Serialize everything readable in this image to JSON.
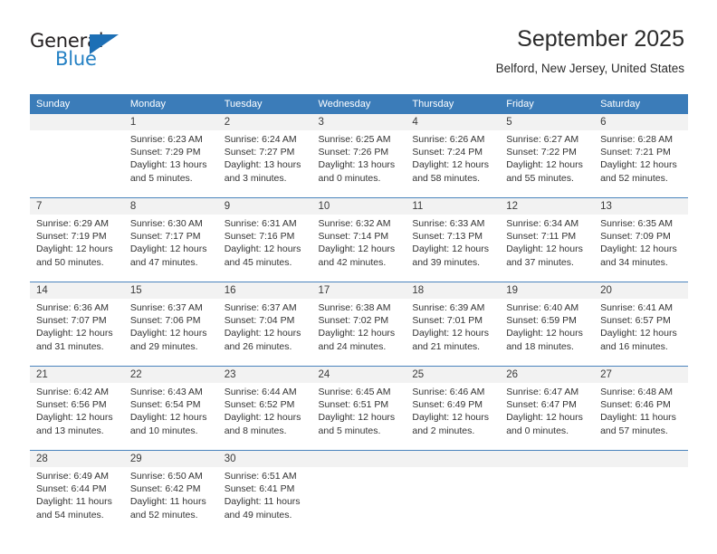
{
  "brand": {
    "name_part1": "General",
    "name_part2": "Blue"
  },
  "header": {
    "title": "September 2025",
    "subtitle": "Belford, New Jersey, United States"
  },
  "colors": {
    "header_blue": "#3b7cb9",
    "separator_blue": "#4a84bd",
    "daynum_bg": "#f2f2f2",
    "logo_blue": "#2581c4"
  },
  "weekday_headers": [
    "Sunday",
    "Monday",
    "Tuesday",
    "Wednesday",
    "Thursday",
    "Friday",
    "Saturday"
  ],
  "weeks": [
    {
      "days": [
        {
          "num": "",
          "sunrise": "",
          "sunset": "",
          "daylight1": "",
          "daylight2": ""
        },
        {
          "num": "1",
          "sunrise": "Sunrise: 6:23 AM",
          "sunset": "Sunset: 7:29 PM",
          "daylight1": "Daylight: 13 hours",
          "daylight2": "and 5 minutes."
        },
        {
          "num": "2",
          "sunrise": "Sunrise: 6:24 AM",
          "sunset": "Sunset: 7:27 PM",
          "daylight1": "Daylight: 13 hours",
          "daylight2": "and 3 minutes."
        },
        {
          "num": "3",
          "sunrise": "Sunrise: 6:25 AM",
          "sunset": "Sunset: 7:26 PM",
          "daylight1": "Daylight: 13 hours",
          "daylight2": "and 0 minutes."
        },
        {
          "num": "4",
          "sunrise": "Sunrise: 6:26 AM",
          "sunset": "Sunset: 7:24 PM",
          "daylight1": "Daylight: 12 hours",
          "daylight2": "and 58 minutes."
        },
        {
          "num": "5",
          "sunrise": "Sunrise: 6:27 AM",
          "sunset": "Sunset: 7:22 PM",
          "daylight1": "Daylight: 12 hours",
          "daylight2": "and 55 minutes."
        },
        {
          "num": "6",
          "sunrise": "Sunrise: 6:28 AM",
          "sunset": "Sunset: 7:21 PM",
          "daylight1": "Daylight: 12 hours",
          "daylight2": "and 52 minutes."
        }
      ]
    },
    {
      "days": [
        {
          "num": "7",
          "sunrise": "Sunrise: 6:29 AM",
          "sunset": "Sunset: 7:19 PM",
          "daylight1": "Daylight: 12 hours",
          "daylight2": "and 50 minutes."
        },
        {
          "num": "8",
          "sunrise": "Sunrise: 6:30 AM",
          "sunset": "Sunset: 7:17 PM",
          "daylight1": "Daylight: 12 hours",
          "daylight2": "and 47 minutes."
        },
        {
          "num": "9",
          "sunrise": "Sunrise: 6:31 AM",
          "sunset": "Sunset: 7:16 PM",
          "daylight1": "Daylight: 12 hours",
          "daylight2": "and 45 minutes."
        },
        {
          "num": "10",
          "sunrise": "Sunrise: 6:32 AM",
          "sunset": "Sunset: 7:14 PM",
          "daylight1": "Daylight: 12 hours",
          "daylight2": "and 42 minutes."
        },
        {
          "num": "11",
          "sunrise": "Sunrise: 6:33 AM",
          "sunset": "Sunset: 7:13 PM",
          "daylight1": "Daylight: 12 hours",
          "daylight2": "and 39 minutes."
        },
        {
          "num": "12",
          "sunrise": "Sunrise: 6:34 AM",
          "sunset": "Sunset: 7:11 PM",
          "daylight1": "Daylight: 12 hours",
          "daylight2": "and 37 minutes."
        },
        {
          "num": "13",
          "sunrise": "Sunrise: 6:35 AM",
          "sunset": "Sunset: 7:09 PM",
          "daylight1": "Daylight: 12 hours",
          "daylight2": "and 34 minutes."
        }
      ]
    },
    {
      "days": [
        {
          "num": "14",
          "sunrise": "Sunrise: 6:36 AM",
          "sunset": "Sunset: 7:07 PM",
          "daylight1": "Daylight: 12 hours",
          "daylight2": "and 31 minutes."
        },
        {
          "num": "15",
          "sunrise": "Sunrise: 6:37 AM",
          "sunset": "Sunset: 7:06 PM",
          "daylight1": "Daylight: 12 hours",
          "daylight2": "and 29 minutes."
        },
        {
          "num": "16",
          "sunrise": "Sunrise: 6:37 AM",
          "sunset": "Sunset: 7:04 PM",
          "daylight1": "Daylight: 12 hours",
          "daylight2": "and 26 minutes."
        },
        {
          "num": "17",
          "sunrise": "Sunrise: 6:38 AM",
          "sunset": "Sunset: 7:02 PM",
          "daylight1": "Daylight: 12 hours",
          "daylight2": "and 24 minutes."
        },
        {
          "num": "18",
          "sunrise": "Sunrise: 6:39 AM",
          "sunset": "Sunset: 7:01 PM",
          "daylight1": "Daylight: 12 hours",
          "daylight2": "and 21 minutes."
        },
        {
          "num": "19",
          "sunrise": "Sunrise: 6:40 AM",
          "sunset": "Sunset: 6:59 PM",
          "daylight1": "Daylight: 12 hours",
          "daylight2": "and 18 minutes."
        },
        {
          "num": "20",
          "sunrise": "Sunrise: 6:41 AM",
          "sunset": "Sunset: 6:57 PM",
          "daylight1": "Daylight: 12 hours",
          "daylight2": "and 16 minutes."
        }
      ]
    },
    {
      "days": [
        {
          "num": "21",
          "sunrise": "Sunrise: 6:42 AM",
          "sunset": "Sunset: 6:56 PM",
          "daylight1": "Daylight: 12 hours",
          "daylight2": "and 13 minutes."
        },
        {
          "num": "22",
          "sunrise": "Sunrise: 6:43 AM",
          "sunset": "Sunset: 6:54 PM",
          "daylight1": "Daylight: 12 hours",
          "daylight2": "and 10 minutes."
        },
        {
          "num": "23",
          "sunrise": "Sunrise: 6:44 AM",
          "sunset": "Sunset: 6:52 PM",
          "daylight1": "Daylight: 12 hours",
          "daylight2": "and 8 minutes."
        },
        {
          "num": "24",
          "sunrise": "Sunrise: 6:45 AM",
          "sunset": "Sunset: 6:51 PM",
          "daylight1": "Daylight: 12 hours",
          "daylight2": "and 5 minutes."
        },
        {
          "num": "25",
          "sunrise": "Sunrise: 6:46 AM",
          "sunset": "Sunset: 6:49 PM",
          "daylight1": "Daylight: 12 hours",
          "daylight2": "and 2 minutes."
        },
        {
          "num": "26",
          "sunrise": "Sunrise: 6:47 AM",
          "sunset": "Sunset: 6:47 PM",
          "daylight1": "Daylight: 12 hours",
          "daylight2": "and 0 minutes."
        },
        {
          "num": "27",
          "sunrise": "Sunrise: 6:48 AM",
          "sunset": "Sunset: 6:46 PM",
          "daylight1": "Daylight: 11 hours",
          "daylight2": "and 57 minutes."
        }
      ]
    },
    {
      "days": [
        {
          "num": "28",
          "sunrise": "Sunrise: 6:49 AM",
          "sunset": "Sunset: 6:44 PM",
          "daylight1": "Daylight: 11 hours",
          "daylight2": "and 54 minutes."
        },
        {
          "num": "29",
          "sunrise": "Sunrise: 6:50 AM",
          "sunset": "Sunset: 6:42 PM",
          "daylight1": "Daylight: 11 hours",
          "daylight2": "and 52 minutes."
        },
        {
          "num": "30",
          "sunrise": "Sunrise: 6:51 AM",
          "sunset": "Sunset: 6:41 PM",
          "daylight1": "Daylight: 11 hours",
          "daylight2": "and 49 minutes."
        },
        {
          "num": "",
          "sunrise": "",
          "sunset": "",
          "daylight1": "",
          "daylight2": ""
        },
        {
          "num": "",
          "sunrise": "",
          "sunset": "",
          "daylight1": "",
          "daylight2": ""
        },
        {
          "num": "",
          "sunrise": "",
          "sunset": "",
          "daylight1": "",
          "daylight2": ""
        },
        {
          "num": "",
          "sunrise": "",
          "sunset": "",
          "daylight1": "",
          "daylight2": ""
        }
      ]
    }
  ]
}
